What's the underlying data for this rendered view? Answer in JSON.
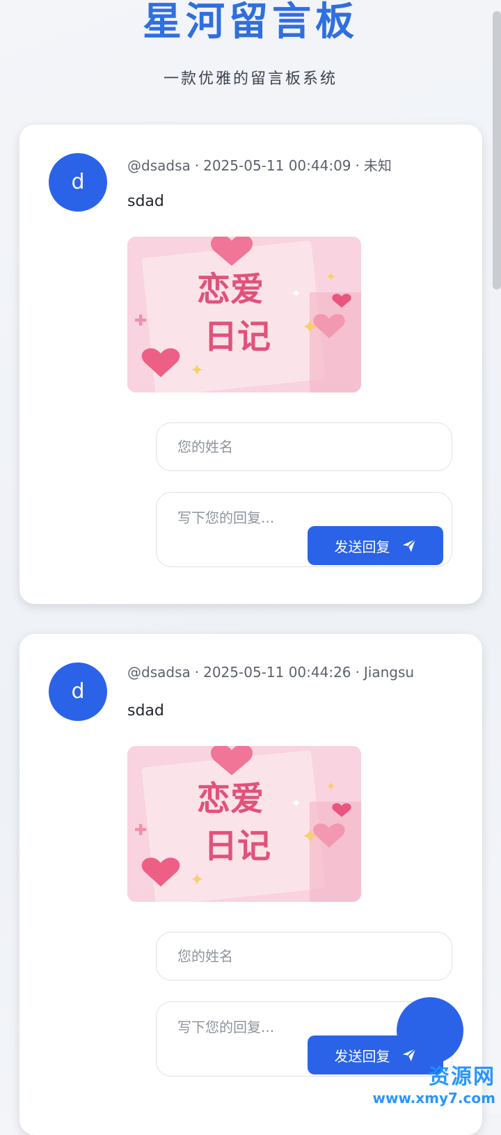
{
  "header": {
    "title": "星河留言板",
    "subtitle": "一款优雅的留言板系统"
  },
  "messages": [
    {
      "avatar_letter": "d",
      "author": "@dsadsa",
      "time": "2025-05-11 00:44:09",
      "location": "未知",
      "content": "sdad",
      "image_text_line1": "恋爱",
      "image_text_line2": "日记",
      "name_placeholder": "您的姓名",
      "reply_placeholder": "写下您的回复...",
      "send_label": "发送回复"
    },
    {
      "avatar_letter": "d",
      "author": "@dsadsa",
      "time": "2025-05-11 00:44:26",
      "location": "Jiangsu",
      "content": "sdad",
      "image_text_line1": "恋爱",
      "image_text_line2": "日记",
      "name_placeholder": "您的姓名",
      "reply_placeholder": "写下您的回复...",
      "send_label": "发送回复"
    }
  ],
  "separator": "·",
  "icons": {
    "send": "paper-plane-icon",
    "image": "sticky-note-hearts-image"
  },
  "colors": {
    "accent": "#2a63e8",
    "title": "#2f6fe0"
  },
  "watermark": {
    "text_cn": "资源网",
    "url": "www.xmy7.com"
  }
}
